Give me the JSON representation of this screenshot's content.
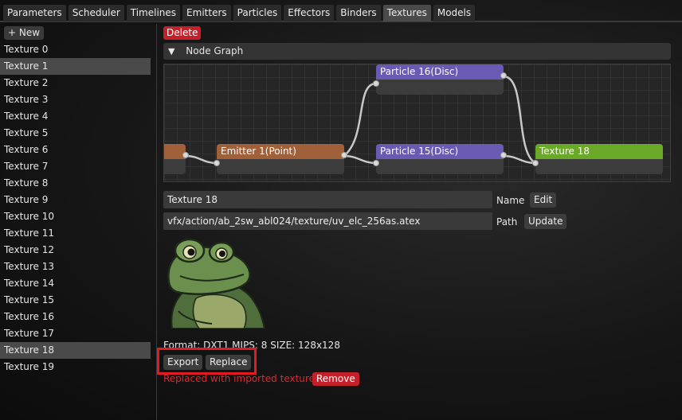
{
  "tabs": [
    "Parameters",
    "Scheduler",
    "Timelines",
    "Emitters",
    "Particles",
    "Effectors",
    "Binders",
    "Textures",
    "Models"
  ],
  "active_tab": "Textures",
  "new_button": "+ New",
  "textures": [
    "Texture 0",
    "Texture 1",
    "Texture 2",
    "Texture 3",
    "Texture 4",
    "Texture 5",
    "Texture 6",
    "Texture 7",
    "Texture 8",
    "Texture 9",
    "Texture 10",
    "Texture 11",
    "Texture 12",
    "Texture 13",
    "Texture 14",
    "Texture 15",
    "Texture 16",
    "Texture 17",
    "Texture 18",
    "Texture 19"
  ],
  "highlighted_textures": [
    "Texture 1",
    "Texture 18"
  ],
  "delete_button": "Delete",
  "node_graph": {
    "header": "Node Graph",
    "nodes": {
      "emitter": "Emitter 1(Point)",
      "particle16": "Particle 16(Disc)",
      "particle15": "Particle 15(Disc)",
      "texture": "Texture 18"
    },
    "colors": {
      "emitter": "#a0603a",
      "particle": "#6a5ab4",
      "texture": "#6aa828"
    }
  },
  "name_field": {
    "value": "Texture 18",
    "label": "Name",
    "button": "Edit"
  },
  "path_field": {
    "value": "vfx/action/ab_2sw_abl024/texture/uv_elc_256as.atex",
    "label": "Path",
    "button": "Update"
  },
  "texture_info": "Format: DXT1  MIPS: 8  SIZE: 128x128",
  "export_button": "Export",
  "replace_button": "Replace",
  "replaced_message": "Replaced with imported texture",
  "remove_button": "Remove"
}
